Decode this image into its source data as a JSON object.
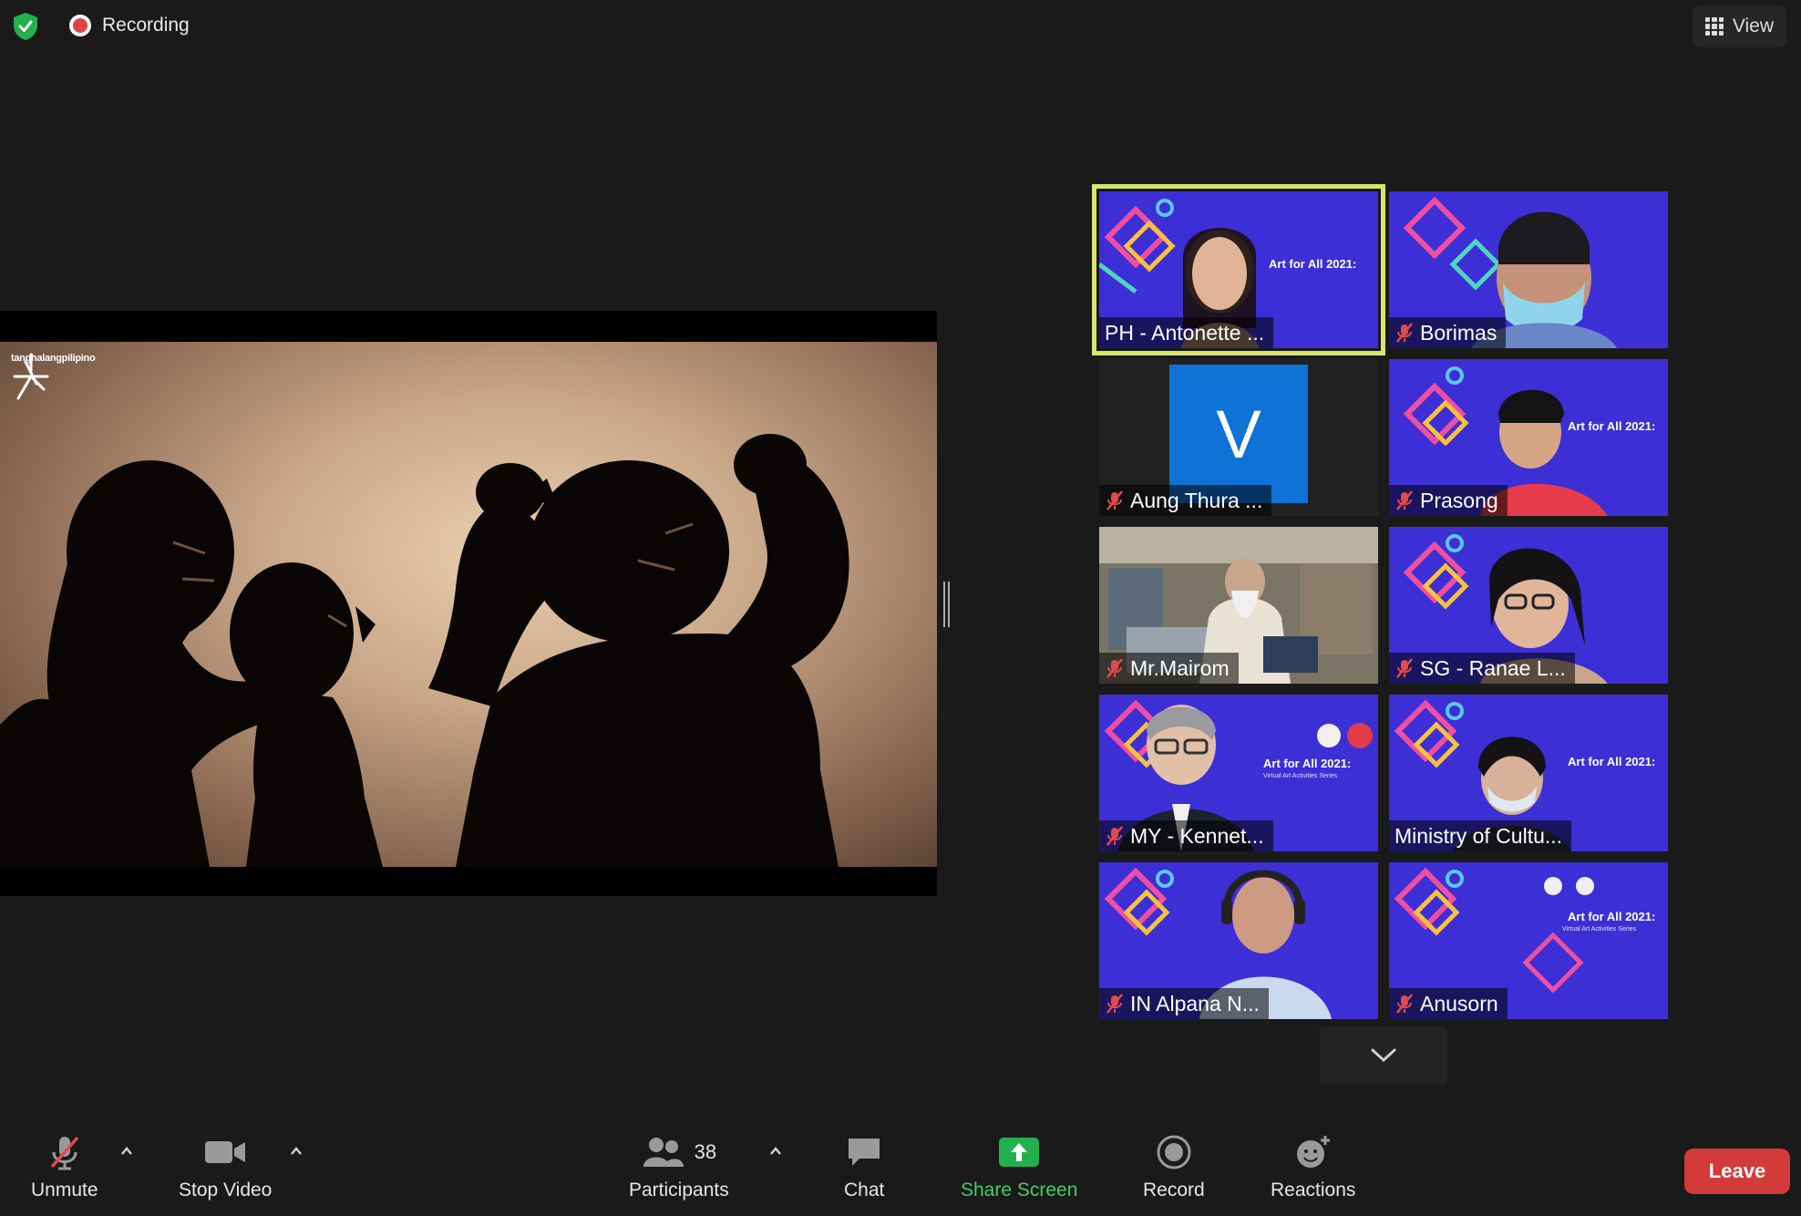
{
  "topbar": {
    "recording_label": "Recording",
    "view_label": "View"
  },
  "share": {
    "logo_text": "tanghalangpilipino"
  },
  "participants": [
    {
      "name": "PH - Antonette ...",
      "muted": false,
      "active": true,
      "type": "poster-person"
    },
    {
      "name": "Borimas",
      "muted": true,
      "active": false,
      "type": "poster-mask"
    },
    {
      "name": "Aung Thura ...",
      "muted": true,
      "active": false,
      "type": "avatar",
      "initial": "V"
    },
    {
      "name": "Prasong",
      "muted": true,
      "active": false,
      "type": "poster-person"
    },
    {
      "name": "Mr.Mairom",
      "muted": true,
      "active": false,
      "type": "room"
    },
    {
      "name": "SG - Ranae L...",
      "muted": true,
      "active": false,
      "type": "poster-person"
    },
    {
      "name": "MY - Kennet...",
      "muted": true,
      "active": false,
      "type": "poster-person"
    },
    {
      "name": "Ministry of Cultu...",
      "muted": false,
      "active": false,
      "type": "poster-person"
    },
    {
      "name": "IN Alpana N...",
      "muted": true,
      "active": false,
      "type": "poster-person"
    },
    {
      "name": "Anusorn",
      "muted": true,
      "active": false,
      "type": "poster"
    }
  ],
  "poster": {
    "title": "Art for All 2021:",
    "subtitle": "Virtual Art Activities Series"
  },
  "toolbar": {
    "unmute": "Unmute",
    "stop_video": "Stop Video",
    "participants": "Participants",
    "participant_count": "38",
    "chat": "Chat",
    "share_screen": "Share Screen",
    "record": "Record",
    "reactions": "Reactions",
    "leave": "Leave"
  },
  "colors": {
    "accent_green": "#3fcf6a",
    "leave_red": "#d33a3a",
    "active_border": "#d7e56e",
    "poster_blue": "#3d2fd6"
  }
}
